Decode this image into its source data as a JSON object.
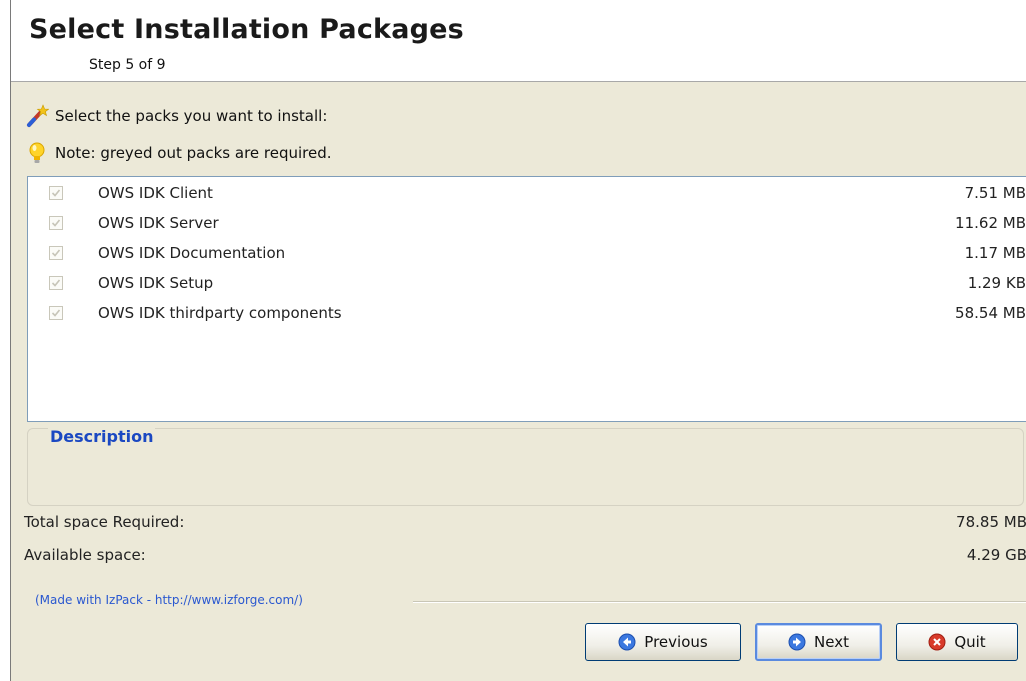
{
  "header": {
    "title": "Select Installation Packages",
    "step": "Step 5 of 9"
  },
  "intro": {
    "select_text": "Select the packs you want to install:",
    "select_icon": "wand-icon",
    "note_text": "Note: greyed out packs are required.",
    "note_icon": "lightbulb-icon"
  },
  "packs": [
    {
      "name": "OWS IDK Client",
      "size": "7.51 MB",
      "checked": true,
      "required": true
    },
    {
      "name": "OWS IDK Server",
      "size": "11.62 MB",
      "checked": true,
      "required": true
    },
    {
      "name": "OWS IDK Documentation",
      "size": "1.17 MB",
      "checked": true,
      "required": true
    },
    {
      "name": "OWS IDK Setup",
      "size": "1.29 KB",
      "checked": true,
      "required": true
    },
    {
      "name": "OWS IDK thirdparty components",
      "size": "58.54 MB",
      "checked": true,
      "required": true
    }
  ],
  "description": {
    "title": "Description"
  },
  "space": {
    "required_label": "Total space Required:",
    "required_value": "78.85 MB",
    "available_label": "Available space:",
    "available_value": "4.29 GB"
  },
  "footer": {
    "credit": "(Made with IzPack - http://www.izforge.com/)",
    "previous_label": "Previous",
    "next_label": "Next",
    "quit_label": "Quit"
  },
  "colors": {
    "panel_bg": "#ece9d8",
    "accent_blue": "#1b48c2",
    "quit_red": "#d83a2a"
  }
}
